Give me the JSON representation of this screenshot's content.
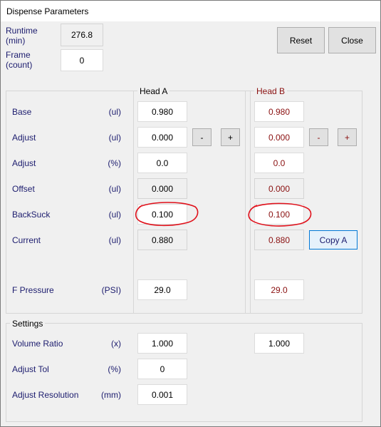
{
  "window": {
    "title": "Dispense Parameters"
  },
  "runtime": {
    "label": "Runtime\n(min)",
    "label_line1": "Runtime",
    "label_line2": "(min)",
    "value": "276.8"
  },
  "frame": {
    "label_line1": "Frame",
    "label_line2": "(count)",
    "value": "0"
  },
  "buttons": {
    "reset": "Reset",
    "close": "Close",
    "copy_a": "Copy A",
    "minus": "-",
    "plus": "+"
  },
  "heads": {
    "a_title": "Head A",
    "b_title": "Head B"
  },
  "rows": [
    {
      "label": "Base",
      "unit": "(ul)",
      "a": "0.980",
      "b": "0.980"
    },
    {
      "label": "Adjust",
      "unit": "(ul)",
      "a": "0.000",
      "b": "0.000"
    },
    {
      "label": "Adjust",
      "unit": "(%)",
      "a": "0.0",
      "b": "0.0"
    },
    {
      "label": "Offset",
      "unit": "(ul)",
      "a": "0.000",
      "b": "0.000"
    },
    {
      "label": "BackSuck",
      "unit": "(ul)",
      "a": "0.100",
      "b": "0.100"
    },
    {
      "label": "Current",
      "unit": "(ul)",
      "a": "0.880",
      "b": "0.880"
    },
    {
      "label": "F Pressure",
      "unit": "(PSI)",
      "a": "29.0",
      "b": "29.0"
    }
  ],
  "settings": {
    "title": "Settings",
    "rows": [
      {
        "label": "Volume Ratio",
        "unit": "(x)",
        "a": "1.000",
        "b": "1.000"
      },
      {
        "label": "Adjust Tol",
        "unit": "(%)",
        "a": "0"
      },
      {
        "label": "Adjust Resolution",
        "unit": "(mm)",
        "a": "0.001"
      }
    ]
  },
  "colors": {
    "annotation": "#e0101a",
    "head_b_text": "#8a1010",
    "label_text": "#1c1c6e",
    "accent": "#0078d7"
  }
}
